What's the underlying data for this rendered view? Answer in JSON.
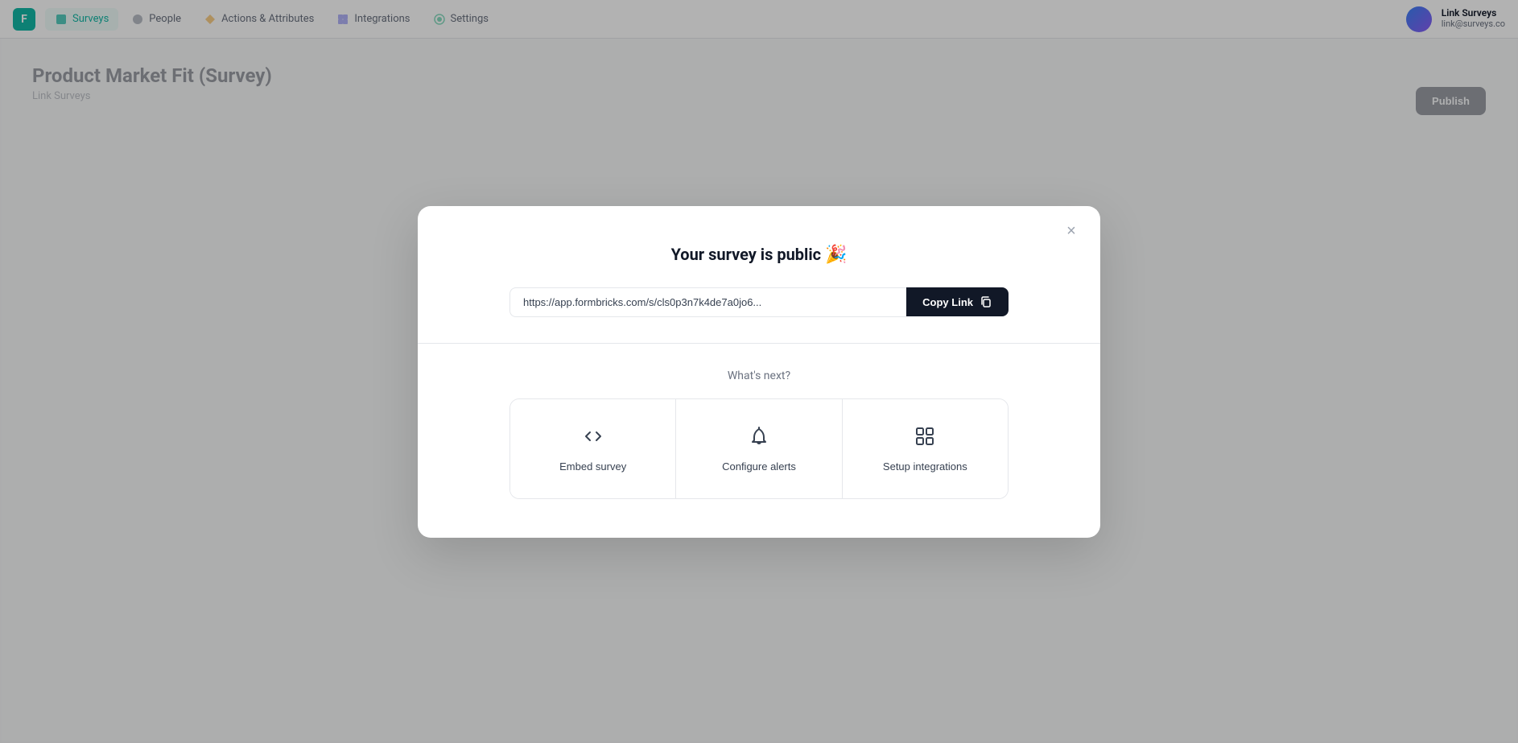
{
  "navbar": {
    "logo_initial": "F",
    "items": [
      {
        "id": "surveys",
        "label": "Surveys",
        "active": true
      },
      {
        "id": "people",
        "label": "People",
        "active": false
      },
      {
        "id": "actions",
        "label": "Actions & Attributes",
        "active": false
      },
      {
        "id": "integrations",
        "label": "Integrations",
        "active": false
      },
      {
        "id": "settings",
        "label": "Settings",
        "active": false
      }
    ],
    "user": {
      "name": "Link Surveys",
      "email": "link@surveys.co"
    }
  },
  "page": {
    "title": "Product Market Fit (Survey)",
    "subtitle": "Link Surveys"
  },
  "publish_button_label": "Publish",
  "modal": {
    "close_label": "×",
    "title": "Your survey is public",
    "title_emoji": "🎉",
    "url_value": "https://app.formbricks.com/s/cls0p3n7k4de7a0jo6...",
    "url_placeholder": "https://app.formbricks.com/s/cls0p3n7k4de7a0jo6...",
    "copy_button_label": "Copy Link",
    "whats_next_label": "What's next?",
    "actions": [
      {
        "id": "embed-survey",
        "label": "Embed survey",
        "icon": "code"
      },
      {
        "id": "configure-alerts",
        "label": "Configure alerts",
        "icon": "bell"
      },
      {
        "id": "setup-integrations",
        "label": "Setup integrations",
        "icon": "grid"
      }
    ]
  }
}
